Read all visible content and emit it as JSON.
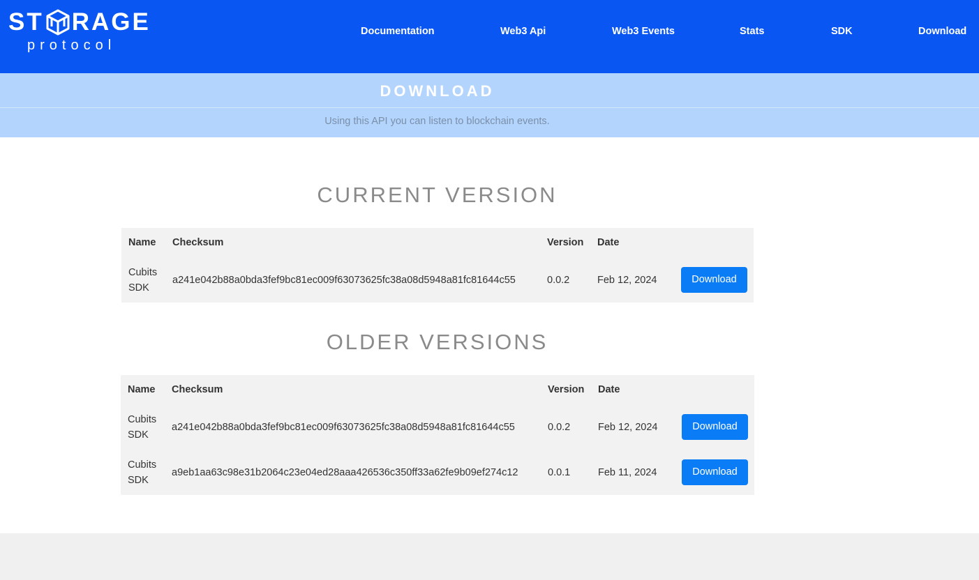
{
  "header": {
    "logo_text_left": "ST",
    "logo_text_right": "RAGE",
    "logo_sub": "protocol",
    "nav": [
      {
        "label": "Documentation"
      },
      {
        "label": "Web3 Api"
      },
      {
        "label": "Web3 Events"
      },
      {
        "label": "Stats"
      },
      {
        "label": "SDK"
      },
      {
        "label": "Download"
      }
    ]
  },
  "banner": {
    "title": "DOWNLOAD",
    "subtitle": "Using this API you can listen to blockchain events."
  },
  "current": {
    "heading": "CURRENT VERSION",
    "columns": {
      "name": "Name",
      "checksum": "Checksum",
      "version": "Version",
      "date": "Date"
    },
    "rows": [
      {
        "name": "Cubits SDK",
        "checksum": "a241e042b88a0bda3fef9bc81ec009f63073625fc38a08d5948a81fc81644c55",
        "version": "0.0.2",
        "date": "Feb 12, 2024",
        "button": "Download"
      }
    ]
  },
  "older": {
    "heading": "OLDER VERSIONS",
    "columns": {
      "name": "Name",
      "checksum": "Checksum",
      "version": "Version",
      "date": "Date"
    },
    "rows": [
      {
        "name": "Cubits SDK",
        "checksum": "a241e042b88a0bda3fef9bc81ec009f63073625fc38a08d5948a81fc81644c55",
        "version": "0.0.2",
        "date": "Feb 12, 2024",
        "button": "Download"
      },
      {
        "name": "Cubits SDK",
        "checksum": "a9eb1aa63c98e31b2064c23e04ed28aaa426536c350ff33a62fe9b09ef274c12",
        "version": "0.0.1",
        "date": "Feb 11, 2024",
        "button": "Download"
      }
    ]
  },
  "colors": {
    "header_bg": "#0a56f2",
    "banner_bg": "#b3d4fd",
    "button_bg": "#0a7cf5",
    "table_bg": "#f2f2f2",
    "footer_bg": "#f0f0f0"
  }
}
